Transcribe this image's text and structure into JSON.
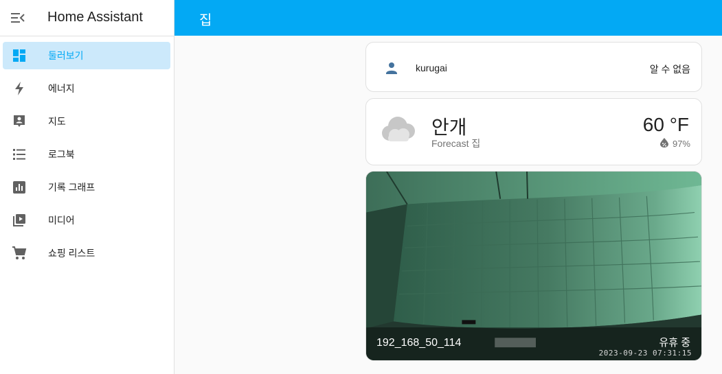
{
  "app": {
    "title": "Home Assistant"
  },
  "sidebar": {
    "items": [
      {
        "label": "둘러보기",
        "icon": "dashboard-icon",
        "active": true
      },
      {
        "label": "에너지",
        "icon": "lightning-bolt-icon"
      },
      {
        "label": "지도",
        "icon": "map-account-icon"
      },
      {
        "label": "로그북",
        "icon": "list-icon"
      },
      {
        "label": "기록 그래프",
        "icon": "chart-box-icon"
      },
      {
        "label": "미디어",
        "icon": "play-box-multiple-icon"
      },
      {
        "label": "쇼핑 리스트",
        "icon": "cart-icon"
      }
    ]
  },
  "header": {
    "title": "집"
  },
  "person_card": {
    "name": "kurugai",
    "state": "알 수 없음",
    "icon": "account-icon"
  },
  "weather_card": {
    "condition": "안개",
    "name": "Forecast 집",
    "temperature": "60 °F",
    "humidity": "97%",
    "icon": "cloud-icon"
  },
  "camera_card": {
    "name": "192_168_50_114",
    "state": "유휴 중",
    "timestamp": "2023-09-23  07:31:15"
  },
  "colors": {
    "accent": "#03a9f4",
    "active_bg": "#cce9fb",
    "icon": "#616161"
  }
}
